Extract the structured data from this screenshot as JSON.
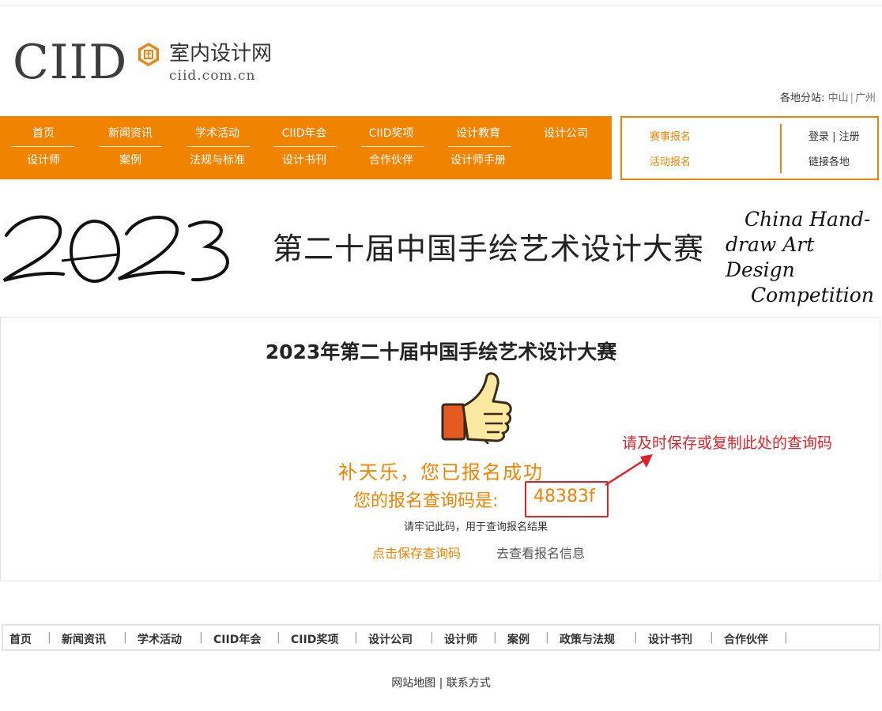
{
  "logo": {
    "mark": "CIID",
    "cn_name": "室内设计网",
    "url_text": "ciid.com.cn"
  },
  "branches": {
    "label": "各地分站:",
    "cities": [
      "中山",
      "广州"
    ]
  },
  "nav": {
    "row1": [
      "首页",
      "新闻资讯",
      "学术活动",
      "CIID年会",
      "CIID奖项",
      "设计教育",
      "设计公司"
    ],
    "row2": [
      "设计师",
      "案例",
      "法规与标准",
      "设计书刊",
      "合作伙伴",
      "设计师手册"
    ]
  },
  "side_box": {
    "contest_signup": "赛事报名",
    "activity_signup": "活动报名",
    "login": "登录",
    "register": "注册",
    "branch_links": "链接各地"
  },
  "banner": {
    "year": "2023",
    "title": "第二十届中国手绘艺术设计大赛",
    "en_line1": "China Hand-",
    "en_line2": "draw Art Design",
    "en_line3": "Competition"
  },
  "result": {
    "title": "2023年第二十届中国手绘艺术设计大赛",
    "success_msg": "补天乐，您已报名成功",
    "code_label": "您的报名查询码是:",
    "code_value": "48383f",
    "remember_tip": "请牢记此码，用于查询报名结果",
    "save_link": "点击保存查询码",
    "view_link": "去查看报名信息"
  },
  "annotation": {
    "text": "请及时保存或复制此处的查询码",
    "color": "#d8242b"
  },
  "footer_nav": [
    "首页",
    "新闻资讯",
    "学术活动",
    "CIID年会",
    "CIID奖项",
    "设计公司",
    "设计师",
    "案例",
    "政策与法规",
    "设计书刊",
    "合作伙伴"
  ],
  "footer_links": [
    "网站地图",
    "联系方式"
  ],
  "colors": {
    "brand_orange": "#f08300",
    "annotation_red": "#d8242b"
  }
}
